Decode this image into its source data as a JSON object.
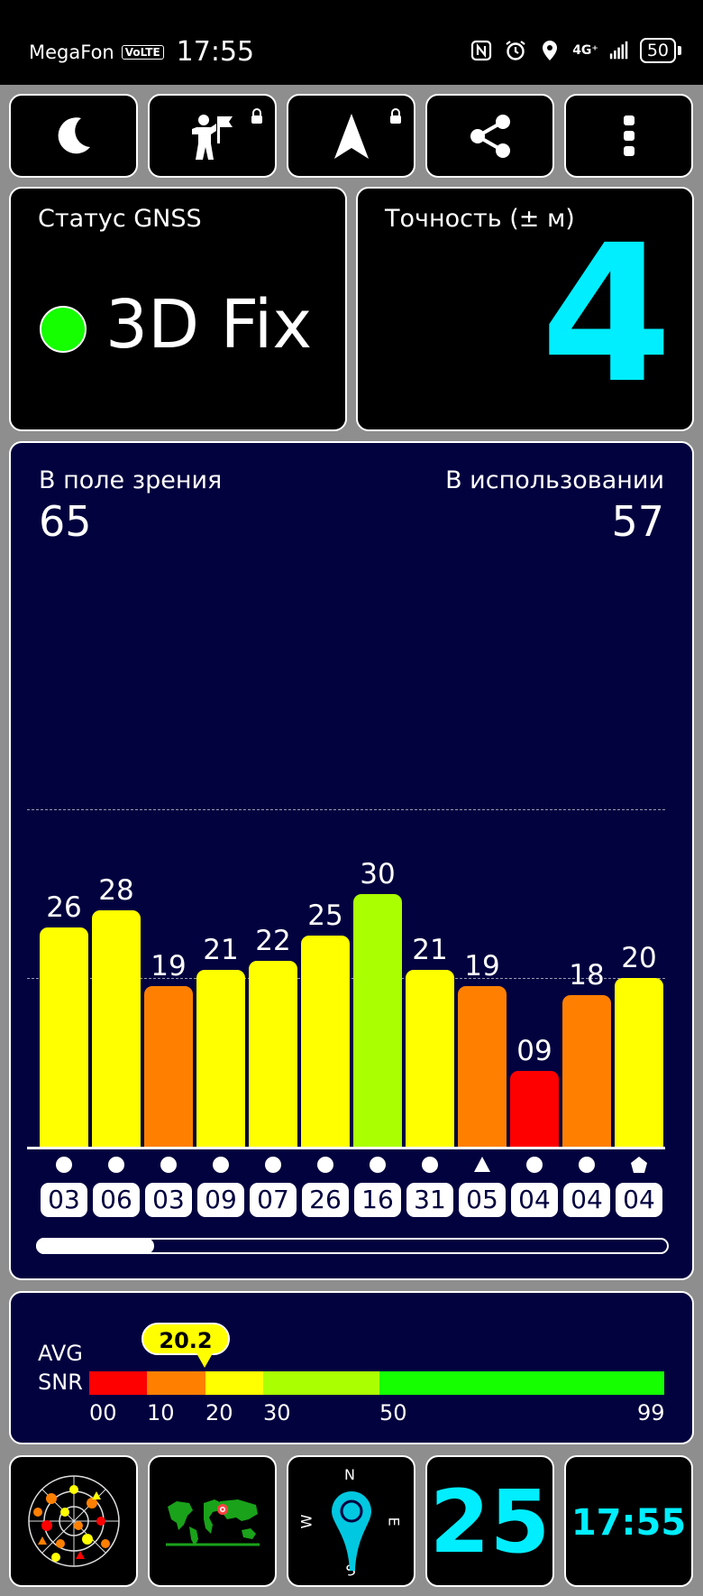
{
  "status_bar": {
    "carrier": "MegaFon",
    "volte": "VoLTE",
    "time": "17:55",
    "network": "4G⁺",
    "battery": "50"
  },
  "toolbar": {
    "icons": [
      "moon-icon",
      "person-flag-icon",
      "navigation-arrow-icon",
      "share-icon",
      "more-vert-icon"
    ]
  },
  "gnss": {
    "title": "Статус GNSS",
    "status": "3D Fix",
    "dot_color": "#15ff00"
  },
  "accuracy": {
    "title": "Точность (± м)",
    "value": "4",
    "color": "#00eeff"
  },
  "satellites": {
    "in_view_label": "В поле зрения",
    "in_view": "65",
    "in_use_label": "В использовании",
    "in_use": "57"
  },
  "chart_data": {
    "type": "bar",
    "categories": [
      "03",
      "06",
      "03",
      "09",
      "07",
      "26",
      "16",
      "31",
      "05",
      "04",
      "04",
      "04"
    ],
    "values": [
      26,
      28,
      19,
      21,
      22,
      25,
      30,
      21,
      19,
      9,
      18,
      20
    ],
    "value_labels": [
      "26",
      "28",
      "19",
      "21",
      "22",
      "25",
      "30",
      "21",
      "19",
      "09",
      "18",
      "20"
    ],
    "markers": [
      "circle",
      "circle",
      "circle",
      "circle",
      "circle",
      "circle",
      "circle",
      "circle",
      "triangle",
      "circle",
      "circle",
      "pentagon"
    ],
    "bar_colors": [
      "#ffff00",
      "#ffff00",
      "#ff8000",
      "#ffff00",
      "#ffff00",
      "#ffff00",
      "#aaff00",
      "#ffff00",
      "#ff8000",
      "#ff0000",
      "#ff8000",
      "#ffff00"
    ],
    "ylim": [
      0,
      50
    ],
    "gridlines": [
      20,
      40
    ],
    "scroll_position": 0.13
  },
  "snr": {
    "label_line1": "AVG",
    "label_line2": "SNR",
    "average": "20.2",
    "average_value": 20.2,
    "ticks": [
      "00",
      "10",
      "20",
      "30",
      "50",
      "99"
    ],
    "segments": [
      {
        "from": 0,
        "to": 10,
        "color": "#ff0000"
      },
      {
        "from": 10,
        "to": 20,
        "color": "#ff8000"
      },
      {
        "from": 20,
        "to": 30,
        "color": "#ffff00"
      },
      {
        "from": 30,
        "to": 50,
        "color": "#aaff00"
      },
      {
        "from": 50,
        "to": 99,
        "color": "#15ff00"
      }
    ]
  },
  "bottom_tiles": {
    "compass": {
      "n": "N",
      "s": "S",
      "w": "W",
      "e": "E"
    },
    "count": "25",
    "clock": "17:55",
    "icons": [
      "sky-plot-icon",
      "world-map-icon",
      "compass-icon"
    ]
  }
}
